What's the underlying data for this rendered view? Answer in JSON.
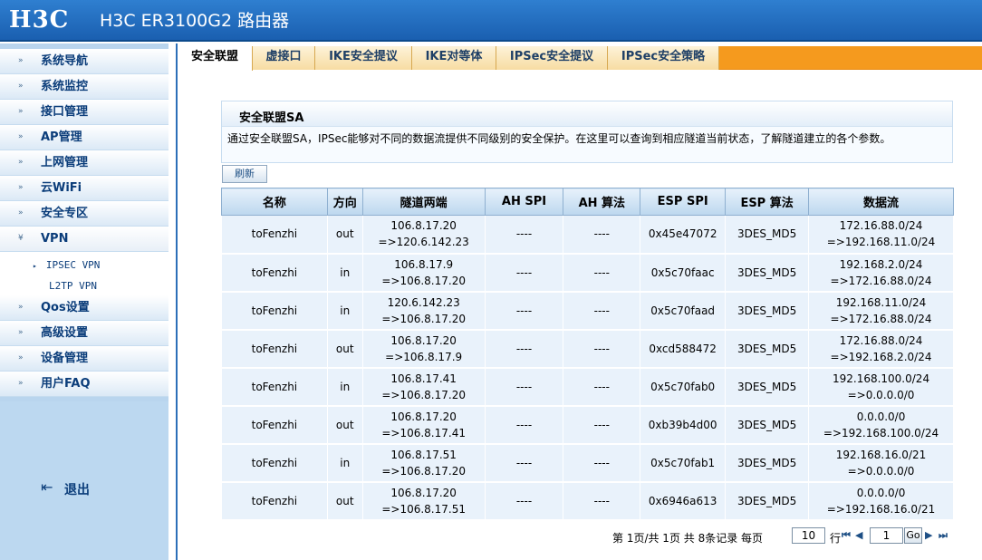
{
  "header": {
    "logo": "H3C",
    "title": "H3C ER3100G2 路由器"
  },
  "sidebar": {
    "items": [
      {
        "label": "系统导航"
      },
      {
        "label": "系统监控"
      },
      {
        "label": "接口管理"
      },
      {
        "label": "AP管理"
      },
      {
        "label": "上网管理"
      },
      {
        "label": "云WiFi"
      },
      {
        "label": "安全专区"
      },
      {
        "label": "VPN"
      },
      {
        "label": "Qos设置"
      },
      {
        "label": "高级设置"
      },
      {
        "label": "设备管理"
      },
      {
        "label": "用户FAQ"
      }
    ],
    "vpn_sub": [
      {
        "label": "IPSEC VPN",
        "selected": true
      },
      {
        "label": "L2TP VPN",
        "selected": false
      }
    ],
    "logout_label": "退出"
  },
  "tabs": [
    {
      "label": "安全联盟",
      "active": true
    },
    {
      "label": "虚接口",
      "active": false
    },
    {
      "label": "IKE安全提议",
      "active": false
    },
    {
      "label": "IKE对等体",
      "active": false
    },
    {
      "label": "IPSec安全提议",
      "active": false
    },
    {
      "label": "IPSec安全策略",
      "active": false
    }
  ],
  "sa_panel": {
    "title": "安全联盟SA",
    "description": "通过安全联盟SA，IPSec能够对不同的数据流提供不同级别的安全保护。在这里可以查询到相应隧道当前状态，了解隧道建立的各个参数。"
  },
  "refresh_label": "刷新",
  "table": {
    "headers": [
      "名称",
      "方向",
      "隧道两端",
      "AH SPI",
      "AH 算法",
      "ESP SPI",
      "ESP 算法",
      "数据流"
    ],
    "rows": [
      {
        "name": "toFenzhi",
        "dir": "out",
        "tunnel_a": "106.8.17.20",
        "tunnel_b": "=>120.6.142.23",
        "ah_spi": "----",
        "ah_alg": "----",
        "esp_spi": "0x45e47072",
        "esp_alg": "3DES_MD5",
        "flow_a": "172.16.88.0/24",
        "flow_b": "=>192.168.11.0/24"
      },
      {
        "name": "toFenzhi",
        "dir": "in",
        "tunnel_a": "106.8.17.9",
        "tunnel_b": "=>106.8.17.20",
        "ah_spi": "----",
        "ah_alg": "----",
        "esp_spi": "0x5c70faac",
        "esp_alg": "3DES_MD5",
        "flow_a": "192.168.2.0/24",
        "flow_b": "=>172.16.88.0/24"
      },
      {
        "name": "toFenzhi",
        "dir": "in",
        "tunnel_a": "120.6.142.23",
        "tunnel_b": "=>106.8.17.20",
        "ah_spi": "----",
        "ah_alg": "----",
        "esp_spi": "0x5c70faad",
        "esp_alg": "3DES_MD5",
        "flow_a": "192.168.11.0/24",
        "flow_b": "=>172.16.88.0/24"
      },
      {
        "name": "toFenzhi",
        "dir": "out",
        "tunnel_a": "106.8.17.20",
        "tunnel_b": "=>106.8.17.9",
        "ah_spi": "----",
        "ah_alg": "----",
        "esp_spi": "0xcd588472",
        "esp_alg": "3DES_MD5",
        "flow_a": "172.16.88.0/24",
        "flow_b": "=>192.168.2.0/24"
      },
      {
        "name": "toFenzhi",
        "dir": "in",
        "tunnel_a": "106.8.17.41",
        "tunnel_b": "=>106.8.17.20",
        "ah_spi": "----",
        "ah_alg": "----",
        "esp_spi": "0x5c70fab0",
        "esp_alg": "3DES_MD5",
        "flow_a": "192.168.100.0/24",
        "flow_b": "=>0.0.0.0/0"
      },
      {
        "name": "toFenzhi",
        "dir": "out",
        "tunnel_a": "106.8.17.20",
        "tunnel_b": "=>106.8.17.41",
        "ah_spi": "----",
        "ah_alg": "----",
        "esp_spi": "0xb39b4d00",
        "esp_alg": "3DES_MD5",
        "flow_a": "0.0.0.0/0",
        "flow_b": "=>192.168.100.0/24"
      },
      {
        "name": "toFenzhi",
        "dir": "in",
        "tunnel_a": "106.8.17.51",
        "tunnel_b": "=>106.8.17.20",
        "ah_spi": "----",
        "ah_alg": "----",
        "esp_spi": "0x5c70fab1",
        "esp_alg": "3DES_MD5",
        "flow_a": "192.168.16.0/21",
        "flow_b": "=>0.0.0.0/0"
      },
      {
        "name": "toFenzhi",
        "dir": "out",
        "tunnel_a": "106.8.17.20",
        "tunnel_b": "=>106.8.17.51",
        "ah_spi": "----",
        "ah_alg": "----",
        "esp_spi": "0x6946a613",
        "esp_alg": "3DES_MD5",
        "flow_a": "0.0.0.0/0",
        "flow_b": "=>192.168.16.0/21"
      }
    ]
  },
  "pager": {
    "page_info": "第 1页/共 1页 共 8条记录 每页",
    "per_page": "10",
    "row_suffix": "行",
    "current_page": "1",
    "go_label": "Go"
  },
  "colors": {
    "header_blue": "#1a5fb0",
    "tab_orange": "#f59a1e",
    "sidebar_bg": "#b9d5ee",
    "row_bg": "#e9f2fb"
  }
}
